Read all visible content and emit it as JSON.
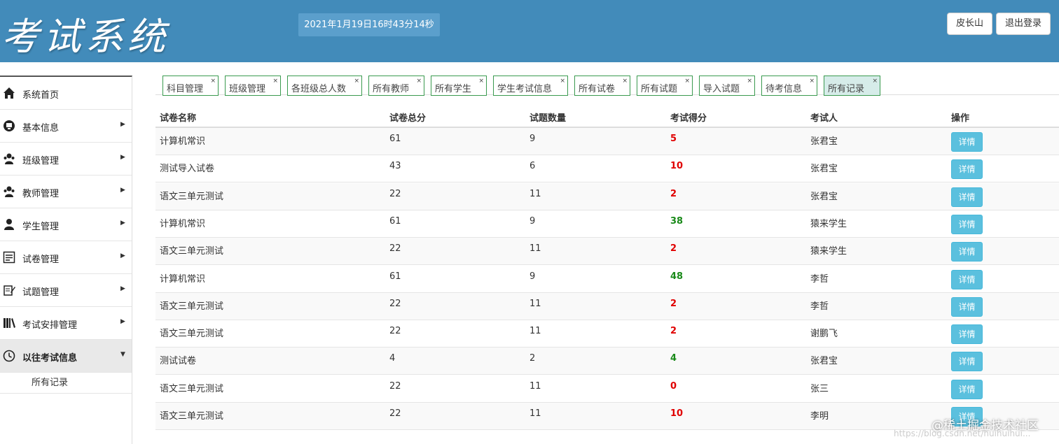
{
  "header": {
    "logo": "考试系统",
    "datetime": "2021年1月19日16时43分14秒",
    "user_button": "皮长山",
    "logout_button": "退出登录"
  },
  "sidebar": {
    "items": [
      {
        "label": "系统首页",
        "icon": "home-icon"
      },
      {
        "label": "基本信息",
        "icon": "monitor-icon"
      },
      {
        "label": "班级管理",
        "icon": "users-icon"
      },
      {
        "label": "教师管理",
        "icon": "users-icon"
      },
      {
        "label": "学生管理",
        "icon": "user-icon"
      },
      {
        "label": "试卷管理",
        "icon": "list-icon"
      },
      {
        "label": "试题管理",
        "icon": "edit-icon"
      },
      {
        "label": "考试安排管理",
        "icon": "books-icon"
      },
      {
        "label": "以往考试信息",
        "icon": "clock-icon"
      }
    ],
    "sub_item": "所有记录"
  },
  "tabs": [
    "科目管理",
    "班级管理",
    "各班级总人数",
    "所有教师",
    "所有学生",
    "学生考试信息",
    "所有试卷",
    "所有试题",
    "导入试题",
    "待考信息",
    "所有记录"
  ],
  "tab_close": "×",
  "table": {
    "headers": [
      "试卷名称",
      "试卷总分",
      "试题数量",
      "考试得分",
      "考试人",
      "操作"
    ],
    "detail_label": "详情",
    "rows": [
      {
        "name": "计算机常识",
        "total": "61",
        "count": "9",
        "score": "5",
        "pass": false,
        "person": "张君宝"
      },
      {
        "name": "测试导入试卷",
        "total": "43",
        "count": "6",
        "score": "10",
        "pass": false,
        "person": "张君宝"
      },
      {
        "name": "语文三单元测试",
        "total": "22",
        "count": "11",
        "score": "2",
        "pass": false,
        "person": "张君宝"
      },
      {
        "name": "计算机常识",
        "total": "61",
        "count": "9",
        "score": "38",
        "pass": true,
        "person": "猿来学生"
      },
      {
        "name": "语文三单元测试",
        "total": "22",
        "count": "11",
        "score": "2",
        "pass": false,
        "person": "猿来学生"
      },
      {
        "name": "计算机常识",
        "total": "61",
        "count": "9",
        "score": "48",
        "pass": true,
        "person": "李哲"
      },
      {
        "name": "语文三单元测试",
        "total": "22",
        "count": "11",
        "score": "2",
        "pass": false,
        "person": "李哲"
      },
      {
        "name": "语文三单元测试",
        "total": "22",
        "count": "11",
        "score": "2",
        "pass": false,
        "person": "谢鹏飞"
      },
      {
        "name": "测试试卷",
        "total": "4",
        "count": "2",
        "score": "4",
        "pass": true,
        "person": "张君宝"
      },
      {
        "name": "语文三单元测试",
        "total": "22",
        "count": "11",
        "score": "0",
        "pass": false,
        "person": "张三"
      },
      {
        "name": "语文三单元测试",
        "total": "22",
        "count": "11",
        "score": "10",
        "pass": false,
        "person": "李明"
      }
    ]
  },
  "colors": {
    "header_bg": "#428bba",
    "score_fail": "#e00000",
    "score_pass": "#1a8a1a",
    "detail_button": "#5bc0de",
    "tab_border": "#3a9a4f"
  },
  "watermark": {
    "text": "@稀土掘金技术社区",
    "url": "https://blog.csdn.net/huihuihui..."
  }
}
